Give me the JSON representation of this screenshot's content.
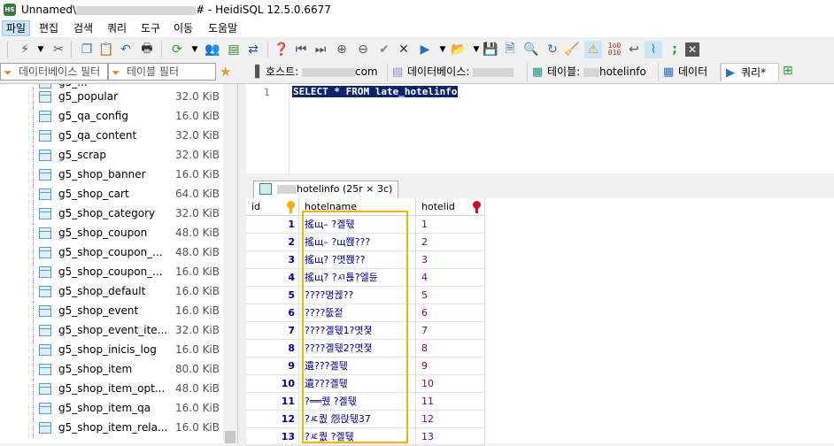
{
  "window": {
    "title_prefix": "Unnamed\\",
    "title_suffix": "# - HeidiSQL 12.5.0.6677",
    "app_icon": "HS"
  },
  "menu": [
    "파일",
    "편집",
    "검색",
    "쿼리",
    "도구",
    "이동",
    "도움말"
  ],
  "toolbar_icons": [
    "connect-icon",
    "dropdown-icon",
    "disconnect-icon",
    "copy-icon",
    "paste-icon",
    "undo-icon",
    "print-icon",
    "refresh-icon",
    "dropdown-icon",
    "user-manager-icon",
    "import-icon",
    "transfer-icon",
    "help-icon",
    "first-icon",
    "last-icon",
    "add-icon",
    "remove-icon",
    "post-icon",
    "cancel-icon",
    "run-icon",
    "dropdown-icon",
    "open-icon",
    "dropdown-icon",
    "save-icon",
    "save-as-icon",
    "find-icon",
    "replace-icon",
    "clear-icon",
    "warning-icon",
    "binary-icon",
    "wrap-icon",
    "format-icon",
    "semicolon-icon",
    "close-icon"
  ],
  "filters": {
    "db_filter": "데이터베이스 필터",
    "table_filter": "테이블 필터"
  },
  "tabs": [
    {
      "label_prefix": "호스트: ",
      "label_suffix": "com"
    },
    {
      "label_prefix": "데이터베이스: ",
      "label_suffix": ""
    },
    {
      "label_prefix": "테이블: ",
      "label_suffix": "hotelinfo"
    },
    {
      "label_prefix": "데이터",
      "label_suffix": ""
    },
    {
      "label_prefix": "쿼리*",
      "label_suffix": ""
    }
  ],
  "tree": [
    {
      "name": "g5_popular",
      "size": "32.0 KiB"
    },
    {
      "name": "g5_qa_config",
      "size": "16.0 KiB"
    },
    {
      "name": "g5_qa_content",
      "size": "32.0 KiB"
    },
    {
      "name": "g5_scrap",
      "size": "32.0 KiB"
    },
    {
      "name": "g5_shop_banner",
      "size": "16.0 KiB"
    },
    {
      "name": "g5_shop_cart",
      "size": "64.0 KiB"
    },
    {
      "name": "g5_shop_category",
      "size": "32.0 KiB"
    },
    {
      "name": "g5_shop_coupon",
      "size": "48.0 KiB"
    },
    {
      "name": "g5_shop_coupon_...",
      "size": "48.0 KiB"
    },
    {
      "name": "g5_shop_coupon_...",
      "size": "16.0 KiB"
    },
    {
      "name": "g5_shop_default",
      "size": "16.0 KiB"
    },
    {
      "name": "g5_shop_event",
      "size": "16.0 KiB"
    },
    {
      "name": "g5_shop_event_ite...",
      "size": "32.0 KiB"
    },
    {
      "name": "g5_shop_inicis_log",
      "size": "16.0 KiB"
    },
    {
      "name": "g5_shop_item",
      "size": "80.0 KiB"
    },
    {
      "name": "g5_shop_item_opt...",
      "size": "48.0 KiB"
    },
    {
      "name": "g5_shop_item_qa",
      "size": "16.0 KiB"
    },
    {
      "name": "g5_shop_item_rela...",
      "size": "16.0 KiB"
    }
  ],
  "editor": {
    "line_number": "1",
    "query": "SELECT * FROM late_hotelinfo"
  },
  "result_tab": {
    "label": "hotelinfo (25r × 3c)"
  },
  "grid": {
    "columns": [
      "id",
      "hotelname",
      "hotelid"
    ],
    "rows": [
      {
        "id": "1",
        "hotelname": "搖щ–  ?곌뒋",
        "hotelid": "1"
      },
      {
        "id": "2",
        "hotelname": "搖щ–  ?щ쫹???",
        "hotelid": "2"
      },
      {
        "id": "3",
        "hotelname": "搖щ? ?몃쫹??",
        "hotelid": "3"
      },
      {
        "id": "4",
        "hotelname": "搖щ? ?ㅺ툕?엘듄",
        "hotelid": "4"
      },
      {
        "id": "5",
        "hotelname": "????명궪??",
        "hotelid": "5"
      },
      {
        "id": "6",
        "hotelname": "????뚮젙",
        "hotelid": "6"
      },
      {
        "id": "7",
        "hotelname": "????곌뒋1?몃졏",
        "hotelid": "7"
      },
      {
        "id": "8",
        "hotelname": "????곌뒋2?몃졏",
        "hotelid": "8"
      },
      {
        "id": "9",
        "hotelname": "遺???곌뒋",
        "hotelid": "9"
      },
      {
        "id": "10",
        "hotelname": "遺???곌뒋",
        "hotelid": "10"
      },
      {
        "id": "11",
        "hotelname": "?══퀬 ?곌뒋",
        "hotelid": "11"
      },
      {
        "id": "12",
        "hotelname": "?ㅼ퀎 怨랁뒋37",
        "hotelid": "12"
      },
      {
        "id": "13",
        "hotelname": "?ㅼ퀎 ?곌뒋",
        "hotelid": "13"
      }
    ]
  },
  "colors": {
    "highlight_border": "#f4b400",
    "selection": "#0a246a",
    "id_key": "#f4b400",
    "hotelid_key": "#c8102e"
  }
}
